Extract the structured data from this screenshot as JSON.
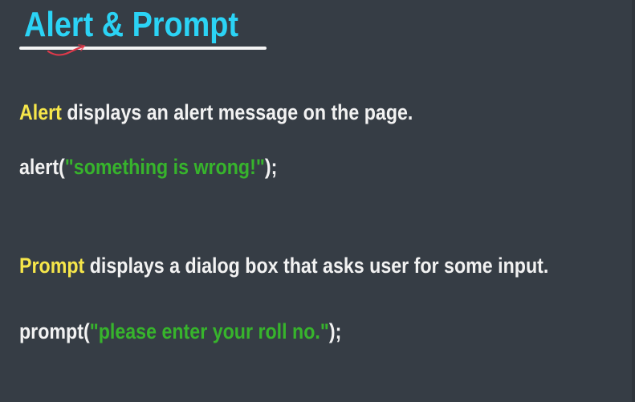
{
  "slide": {
    "title": "Alert & Prompt",
    "alert_description": {
      "keyword": "Alert",
      "text": " displays an alert message on the page."
    },
    "alert_code": {
      "prefix": "alert(",
      "string": "\"something is wrong!\"",
      "suffix": ");"
    },
    "prompt_description": {
      "keyword": "Prompt",
      "text": " displays a dialog box that asks user for some input."
    },
    "prompt_code": {
      "prefix": "prompt(",
      "string": "\"please enter your roll no.\"",
      "suffix": ");"
    }
  },
  "colors": {
    "background": "#363d45",
    "title": "#2bd3f5",
    "keyword": "#f6e64a",
    "string": "#37b42c",
    "text": "#f2f2f2",
    "pen_mark": "#e0394a"
  }
}
